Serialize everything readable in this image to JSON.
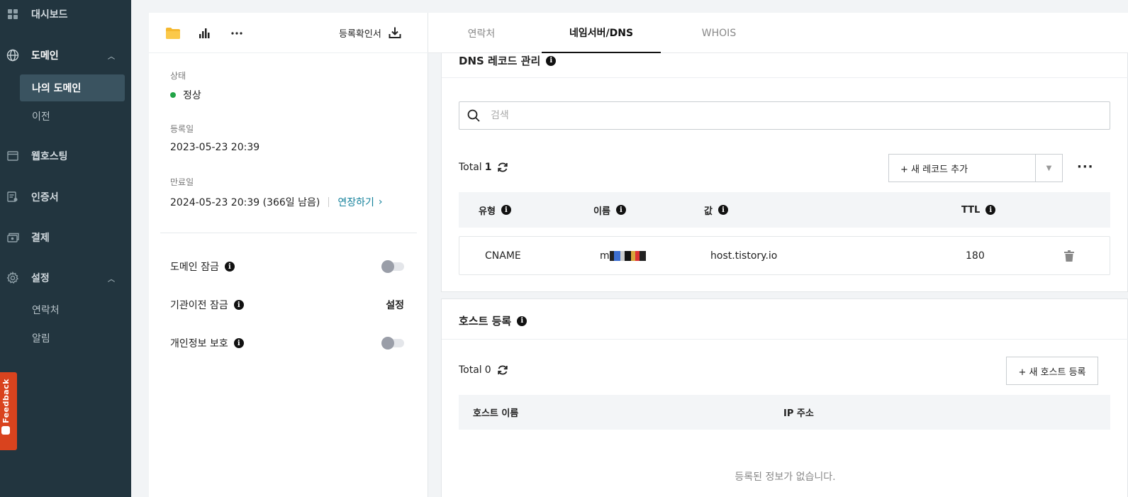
{
  "sidebar": {
    "items": [
      {
        "label": "대시보드",
        "icon": "dashboard-icon"
      },
      {
        "label": "도메인",
        "icon": "globe-icon",
        "expanded": true
      },
      {
        "label": "웹호스팅",
        "icon": "window-icon"
      },
      {
        "label": "인증서",
        "icon": "certificate-icon"
      },
      {
        "label": "결제",
        "icon": "payment-icon"
      },
      {
        "label": "설정",
        "icon": "gear-icon",
        "expanded": true
      }
    ],
    "domain_sub": [
      {
        "label": "나의 도메인",
        "active": true
      },
      {
        "label": "이전"
      }
    ],
    "settings_sub": [
      {
        "label": "연락처"
      },
      {
        "label": "알림"
      }
    ],
    "feedback_label": "Feedback"
  },
  "left_panel": {
    "toolbar": {
      "icons": [
        "folder-icon",
        "bar-chart-icon",
        "more-icon"
      ],
      "certificate_label": "등록확인서"
    },
    "status": {
      "label": "상태",
      "value": "정상",
      "color": "#22a447"
    },
    "registered": {
      "label": "등록일",
      "value": "2023-05-23 20:39"
    },
    "expiry": {
      "label": "만료일",
      "value": "2024-05-23 20:39 (366일 남음)",
      "renew_label": "연장하기"
    },
    "settings": [
      {
        "label": "도메인 잠금",
        "control": "toggle",
        "on": false
      },
      {
        "label": "기관이전 잠금",
        "control": "link",
        "link_label": "설정"
      },
      {
        "label": "개인정보 보호",
        "control": "toggle",
        "on": false
      }
    ]
  },
  "tabs": [
    {
      "label": "연락처"
    },
    {
      "label": "네임서버/DNS",
      "active": true
    },
    {
      "label": "WHOIS"
    }
  ],
  "dns": {
    "title": "DNS 레코드 관리",
    "search_placeholder": "검색",
    "total_label": "Total",
    "total_count": "1",
    "add_label": "+ 새 레코드 추가",
    "columns": [
      "유형",
      "이름",
      "값",
      "TTL"
    ],
    "rows": [
      {
        "type": "CNAME",
        "name": "m",
        "value": "host.tistory.io",
        "ttl": "180"
      }
    ]
  },
  "hosts": {
    "title": "호스트 등록",
    "total_label": "Total",
    "total_count": "0",
    "add_label": "+ 새 호스트 등록",
    "columns": [
      "호스트 이름",
      "IP 주소"
    ],
    "empty_text": "등록된 정보가 없습니다."
  }
}
